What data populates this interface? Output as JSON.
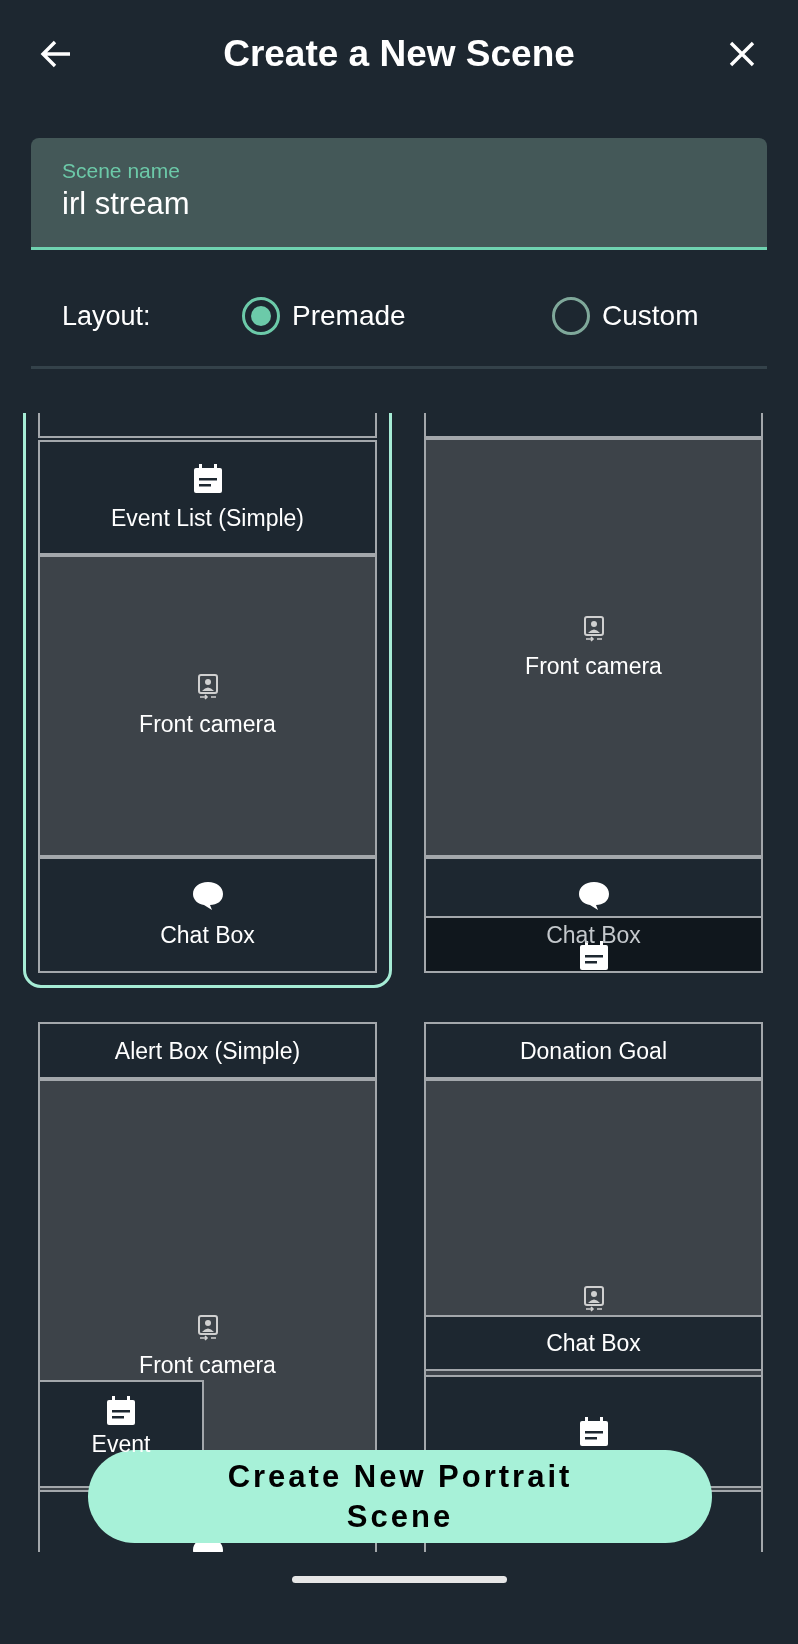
{
  "header": {
    "title": "Create a New Scene"
  },
  "scene_name": {
    "label": "Scene name",
    "value": "irl stream"
  },
  "layout": {
    "label": "Layout:",
    "options": [
      {
        "label": "Premade",
        "selected": true
      },
      {
        "label": "Custom",
        "selected": false
      }
    ]
  },
  "templates": [
    {
      "selected": true,
      "regions": [
        {
          "kind": "alert"
        },
        {
          "kind": "event_list",
          "label": "Event List (Simple)"
        },
        {
          "kind": "camera",
          "label": "Front camera"
        },
        {
          "kind": "chat",
          "label": "Chat Box"
        }
      ]
    },
    {
      "selected": false,
      "regions": [
        {
          "kind": "alert"
        },
        {
          "kind": "camera",
          "label": "Front camera"
        },
        {
          "kind": "chat",
          "label": "Chat Box"
        },
        {
          "kind": "event_list"
        }
      ]
    },
    {
      "selected": false,
      "regions": [
        {
          "kind": "alert",
          "label": "Alert Box (Simple)"
        },
        {
          "kind": "camera",
          "label": "Front camera"
        },
        {
          "kind": "event_list",
          "label": "Event"
        },
        {
          "kind": "chat"
        }
      ]
    },
    {
      "selected": false,
      "regions": [
        {
          "kind": "goal",
          "label": "Donation Goal"
        },
        {
          "kind": "camera"
        },
        {
          "kind": "chat",
          "label": "Chat Box"
        },
        {
          "kind": "event_list"
        },
        {
          "kind": "alert"
        }
      ]
    }
  ],
  "create_button": {
    "label": "Create New Portrait Scene"
  }
}
